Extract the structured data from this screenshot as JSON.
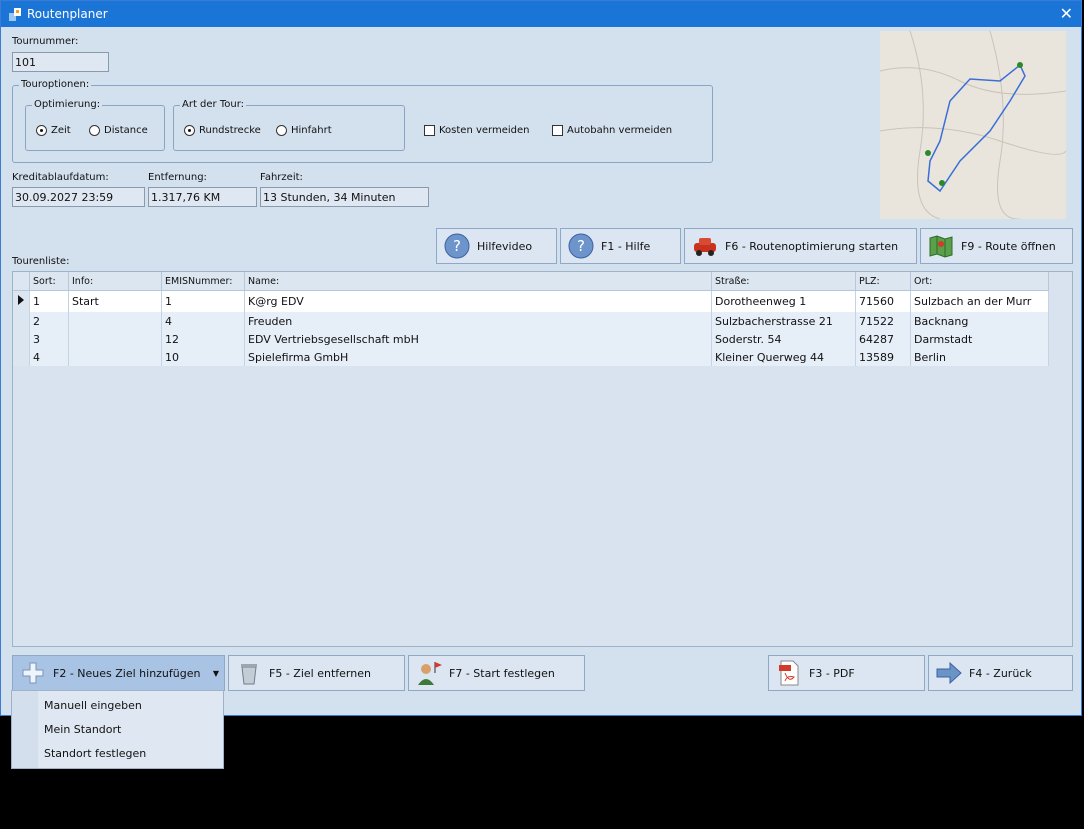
{
  "window": {
    "title": "Routenplaner",
    "close_glyph": "✕"
  },
  "header": {
    "tournummer_label": "Tournummer:",
    "tournummer_value": "101"
  },
  "touroptionen": {
    "label": "Touroptionen:",
    "optimierung": {
      "label": "Optimierung:",
      "options": [
        "Zeit",
        "Distance"
      ],
      "selected": "Zeit"
    },
    "art": {
      "label": "Art der Tour:",
      "options": [
        "Rundstrecke",
        "Hinfahrt"
      ],
      "selected": "Rundstrecke"
    },
    "checks": [
      "Kosten vermeiden",
      "Autobahn vermeiden"
    ]
  },
  "info": {
    "kredit_label": "Kreditablaufdatum:",
    "kredit_value": "30.09.2027 23:59",
    "entfernung_label": "Entfernung:",
    "entfernung_value": "1.317,76 KM",
    "fahrzeit_label": "Fahrzeit:",
    "fahrzeit_value": "13 Stunden, 34 Minuten"
  },
  "actions": {
    "hilfevideo": "Hilfevideo",
    "hilfe": "F1 - Hilfe",
    "optimierung": "F6 - Routenoptimierung starten",
    "route": "F9 - Route öffnen"
  },
  "table": {
    "title": "Tourenliste:",
    "headers": [
      "Sort:",
      "Info:",
      "EMISNummer:",
      "Name:",
      "Straße:",
      "PLZ:",
      "Ort:"
    ],
    "rows": [
      [
        "1",
        "Start",
        "1",
        "K@rg EDV",
        "Dorotheenweg 1",
        "71560",
        "Sulzbach an der Murr"
      ],
      [
        "2",
        "",
        "4",
        "Freuden",
        "Sulzbacherstrasse 21",
        "71522",
        "Backnang"
      ],
      [
        "3",
        "",
        "12",
        "EDV Vertriebsgesellschaft mbH",
        "Soderstr. 54",
        "64287",
        "Darmstadt"
      ],
      [
        "4",
        "",
        "10",
        "Spielefirma GmbH",
        "Kleiner Querweg 44",
        "13589",
        "Berlin"
      ]
    ]
  },
  "bottom": {
    "add": "F2 - Neues Ziel hinzufügen",
    "remove": "F5 - Ziel entfernen",
    "start": "F7 - Start festlegen",
    "pdf": "F3 - PDF",
    "back": "F4 - Zurück"
  },
  "menu": {
    "items": [
      "Manuell eingeben",
      "Mein Standort",
      "Standort festlegen"
    ]
  },
  "icons": {
    "app": "app-icon",
    "help": "question-circle-icon",
    "car": "car-icon",
    "map": "map-icon",
    "plus": "plus-icon",
    "trash": "trash-icon",
    "user": "user-flag-icon",
    "pdf": "pdf-icon",
    "arrow": "arrow-right-icon"
  }
}
